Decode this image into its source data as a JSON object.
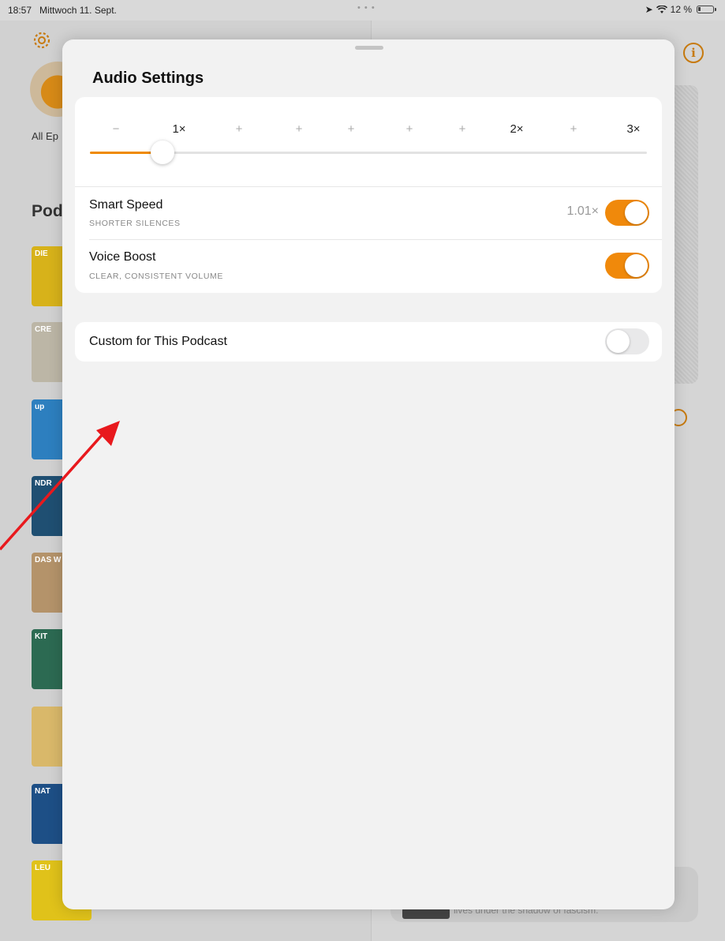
{
  "status_bar": {
    "time": "18:57",
    "date": "Mittwoch 11. Sept.",
    "battery": "12 %"
  },
  "background": {
    "all_episodes_label": "All Ep",
    "section_heading": "Pod",
    "podcast_tiles": [
      {
        "name": "podcast-tile-1",
        "text": "DIE",
        "color": "#d7b21a"
      },
      {
        "name": "podcast-tile-2",
        "text": "CRE",
        "color": "#bcb6a6"
      },
      {
        "name": "podcast-tile-3",
        "text": "up",
        "color": "#2d7fbf"
      },
      {
        "name": "podcast-tile-4",
        "text": "NDR",
        "color": "#1f4f72"
      },
      {
        "name": "podcast-tile-5",
        "text": "DAS W",
        "color": "#b4936a"
      },
      {
        "name": "podcast-tile-6",
        "text": "KIT",
        "color": "#2c6a52"
      },
      {
        "name": "podcast-tile-7",
        "text": "",
        "color": "#d9b86a"
      },
      {
        "name": "podcast-tile-8",
        "text": "NAT",
        "color": "#1d4f86"
      },
      {
        "name": "podcast-tile-9",
        "text": "LEU",
        "color": "#e0c21a"
      }
    ],
    "now_playing_text": "lives under the shadow of fascism."
  },
  "audio_settings": {
    "title": "Audio Settings",
    "speed": {
      "ticks": [
        {
          "label": "−",
          "major": false
        },
        {
          "label": "1×",
          "major": true
        },
        {
          "label": "+",
          "major": false
        },
        {
          "label": "+",
          "major": false
        },
        {
          "label": "+",
          "major": false
        },
        {
          "label": "+",
          "major": false
        },
        {
          "label": "+",
          "major": false
        },
        {
          "label": "2×",
          "major": true
        },
        {
          "label": "+",
          "major": false
        },
        {
          "label": "3×",
          "major": true
        }
      ],
      "current_speed": "1×"
    },
    "smart_speed": {
      "title": "Smart Speed",
      "subtitle": "SHORTER SILENCES",
      "value": "1.01×",
      "enabled": true
    },
    "voice_boost": {
      "title": "Voice Boost",
      "subtitle": "CLEAR, CONSISTENT VOLUME",
      "enabled": true
    },
    "custom_for_podcast": {
      "title": "Custom for This Podcast",
      "enabled": false
    }
  },
  "colors": {
    "accent": "#f0890b",
    "annotation_arrow": "#e8191d"
  }
}
